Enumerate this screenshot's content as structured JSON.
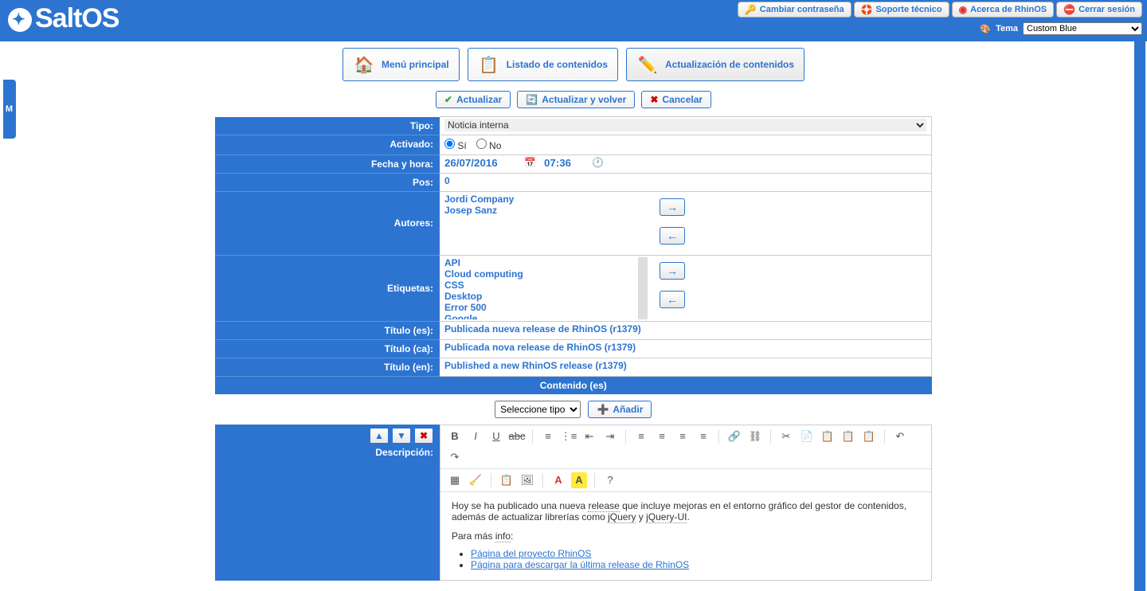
{
  "brand": "SaltOS",
  "topLinks": {
    "password": "Cambiar contraseña",
    "support": "Soporte técnico",
    "about": "Acerca de RhinOS",
    "logout": "Cerrar sesión"
  },
  "theme": {
    "label": "Tema",
    "value": "Custom Blue"
  },
  "menuTab": "MENU",
  "nav": {
    "main": "Menú principal",
    "list": "Listado de contenidos",
    "update": "Actualización de contenidos"
  },
  "actions": {
    "update": "Actualizar",
    "updateBack": "Actualizar y volver",
    "cancel": "Cancelar"
  },
  "form": {
    "tipo": {
      "label": "Tipo:",
      "value": "Noticia interna"
    },
    "activado": {
      "label": "Activado:",
      "yes": "Sí",
      "no": "No"
    },
    "fecha": {
      "label": "Fecha y hora:",
      "date": "26/07/2016",
      "time": "07:36"
    },
    "pos": {
      "label": "Pos:",
      "value": "0"
    },
    "autores": {
      "label": "Autores:",
      "items": [
        "Jordi Company",
        "Josep Sanz"
      ]
    },
    "etiquetas": {
      "label": "Etiquetas:",
      "items": [
        "API",
        "Cloud computing",
        "CSS",
        "Desktop",
        "Error 500",
        "Google"
      ]
    },
    "titulo_es": {
      "label": "Título (es):",
      "value": "Publicada nueva release de RhinOS (r1379)"
    },
    "titulo_ca": {
      "label": "Título (ca):",
      "value": "Publicada nova release de RhinOS (r1379)"
    },
    "titulo_en": {
      "label": "Título (en):",
      "value": "Published a new RhinOS release (r1379)"
    }
  },
  "contentHeader": "Contenido (es)",
  "addRow": {
    "select": "Seleccione tipo",
    "button": "Añadir"
  },
  "descripcion": {
    "label": "Descripción:"
  },
  "editor": {
    "para1a": "Hoy se ha publicado una nueva ",
    "para1_release": "release",
    "para1b": " que incluye mejoras en el entorno gráfico del gestor de contenidos, además de actualizar librerías como ",
    "para1_jq": "jQuery",
    "para1_and": " y ",
    "para1_jqui": "jQuery-UI",
    "para1c": ".",
    "para2a": "Para más ",
    "para2_info": "info",
    "para2b": ":",
    "link1": "Página del proyecto RhinOS",
    "link2": "Página para descargar la última release de RhinOS"
  }
}
